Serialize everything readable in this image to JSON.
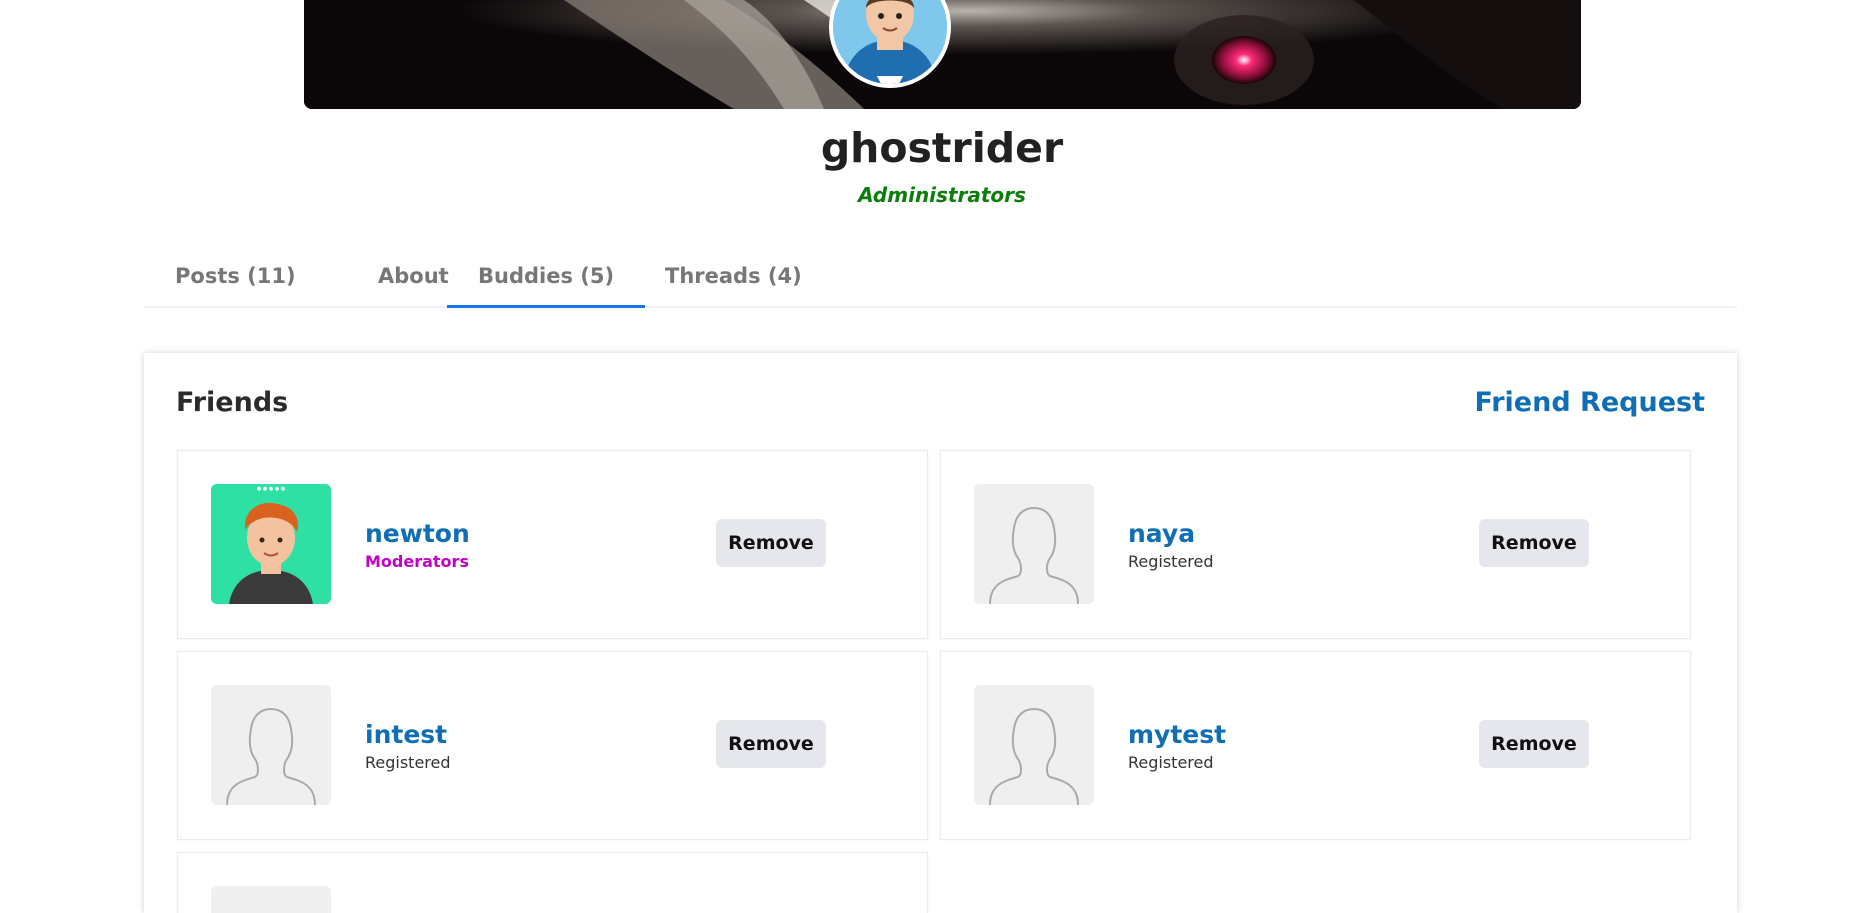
{
  "profile": {
    "username": "ghostrider",
    "usergroup": "Administrators",
    "usergroup_color": "#0b7d0b"
  },
  "tabs": [
    {
      "label": "Posts (11)"
    },
    {
      "label": "About"
    },
    {
      "label": "Buddies (5)",
      "active": true
    },
    {
      "label": "Threads (4)"
    }
  ],
  "friends": {
    "title": "Friends",
    "request_link": "Friend Request",
    "remove_label": "Remove",
    "items": [
      {
        "name": "newton",
        "group": "Moderators",
        "group_color": "#c300c8",
        "avatar": "cartoon-avatar"
      },
      {
        "name": "naya",
        "group": "Registered",
        "avatar": "default-avatar"
      },
      {
        "name": "intest",
        "group": "Registered",
        "avatar": "default-avatar"
      },
      {
        "name": "mytest",
        "group": "Registered",
        "avatar": "default-avatar"
      }
    ]
  },
  "colors": {
    "link": "#106eb4",
    "tab_active_underline": "#1a73e8",
    "button_bg": "#e5e7ec"
  }
}
